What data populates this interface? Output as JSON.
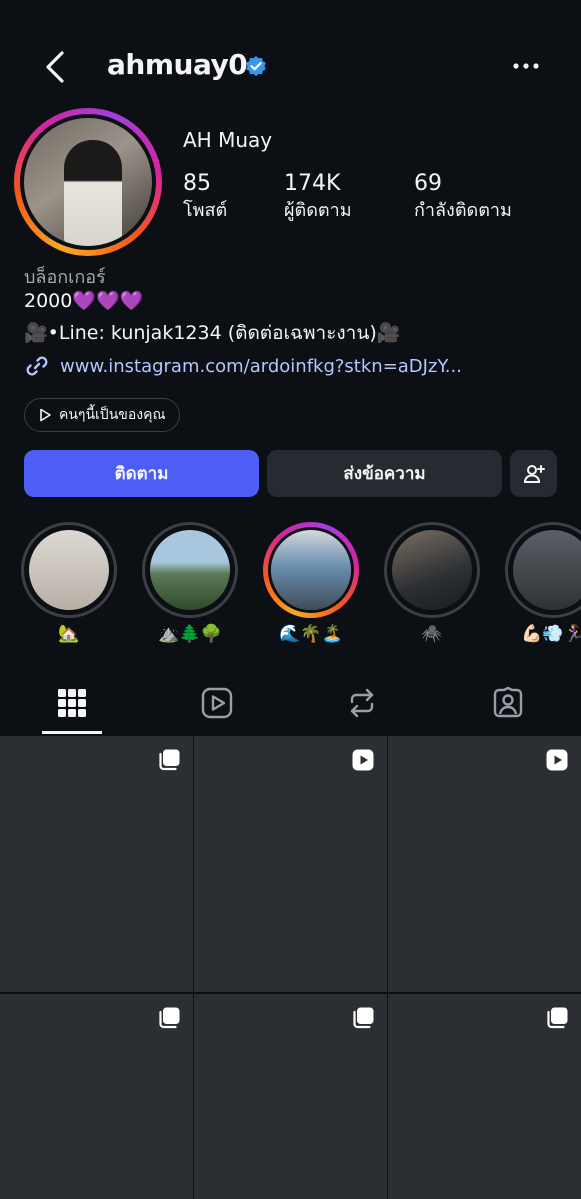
{
  "header": {
    "username": "ahmuay0",
    "verified": true
  },
  "profile": {
    "display_name": "AH Muay",
    "stats": {
      "posts": {
        "value": "85",
        "label": "โพสต์"
      },
      "followers": {
        "value": "174K",
        "label": "ผู้ติดตาม"
      },
      "following": {
        "value": "69",
        "label": "กำลังติดตาม"
      }
    },
    "category": "บล็อกเกอร์",
    "bio_line1": "2000💜💜💜",
    "bio_line2": "🎥•Line: kunjak1234 (ติดต่อเฉพาะงาน)🎥",
    "link": "www.instagram.com/ardoinfkg?stkn=aDJzY..."
  },
  "chip": {
    "label": "คนๆนี้เป็นของคุณ"
  },
  "buttons": {
    "follow": "ติดตาม",
    "message": "ส่งข้อความ"
  },
  "highlights": [
    {
      "label": "🏡",
      "active": false
    },
    {
      "label": "⛰️🌲🌳",
      "active": false
    },
    {
      "label": "🌊🌴🏝️",
      "active": true
    },
    {
      "label": "🕷️",
      "active": false
    },
    {
      "label": "💪🏻💨🏃‍♀️",
      "active": false
    }
  ],
  "tabs": [
    "grid",
    "reels",
    "reposts",
    "tagged"
  ],
  "selected_tab": "grid",
  "posts": [
    {
      "type": "carousel"
    },
    {
      "type": "reel"
    },
    {
      "type": "reel"
    },
    {
      "type": "carousel"
    },
    {
      "type": "carousel"
    },
    {
      "type": "carousel"
    }
  ],
  "colors": {
    "background": "#0c0f14",
    "follow_button": "#4c5ef6",
    "secondary_button": "#262a31",
    "link": "#b4c6ff",
    "verified": "#3897f0"
  }
}
